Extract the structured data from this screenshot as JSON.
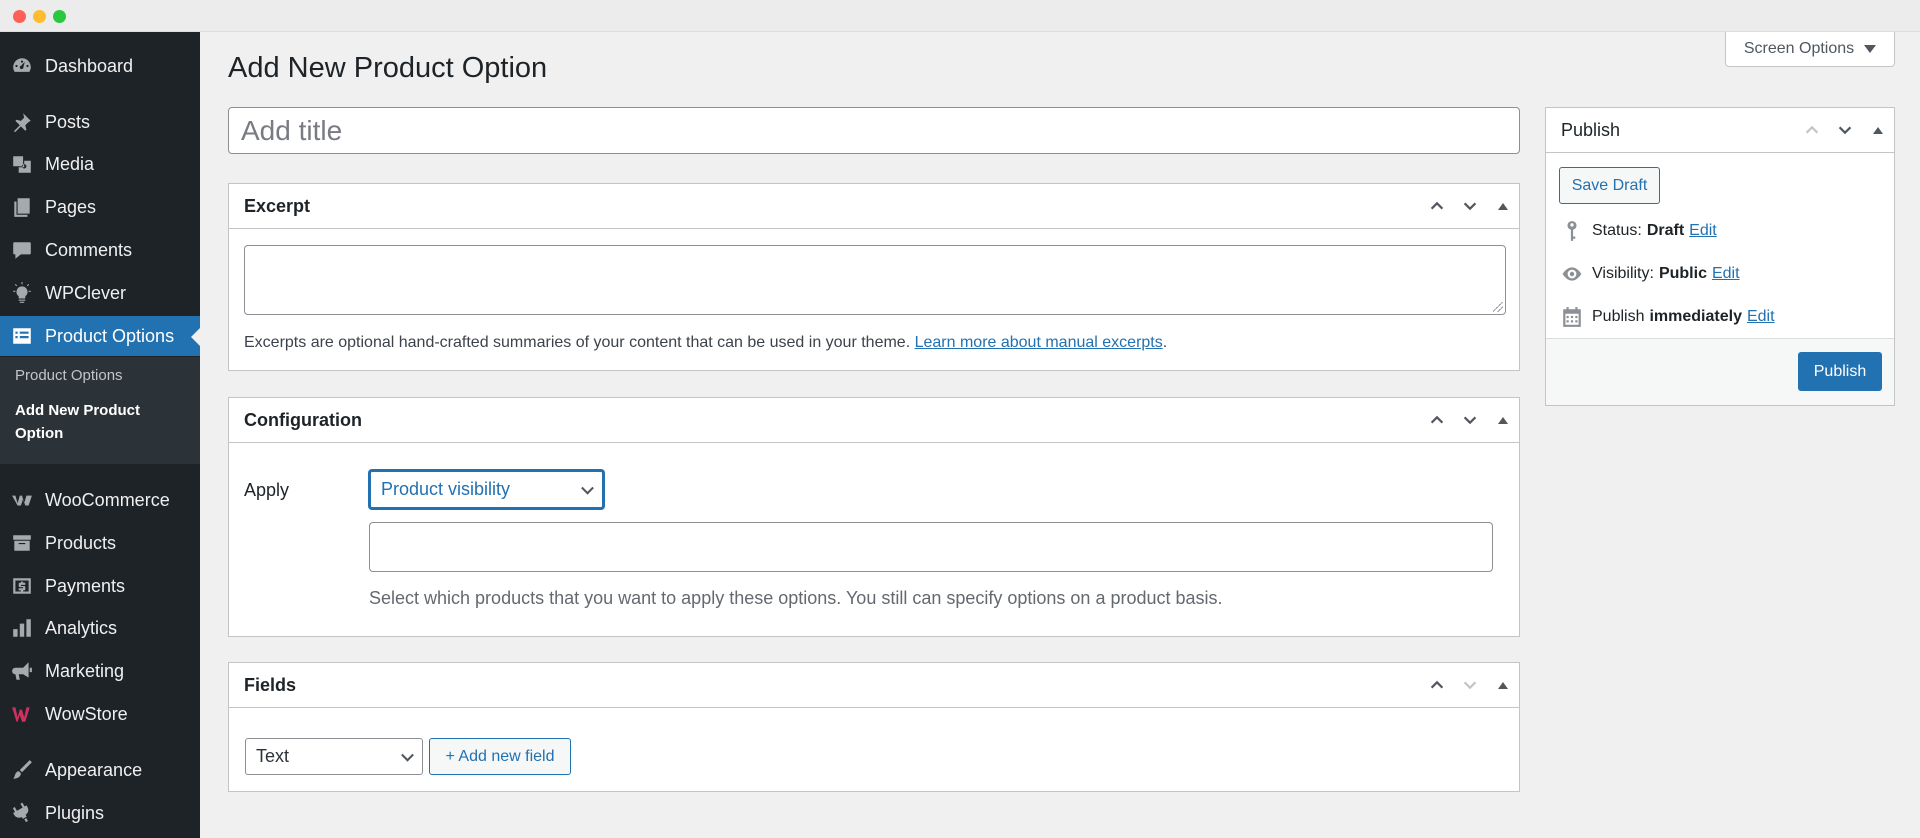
{
  "sidebar": {
    "items": [
      {
        "label": "Dashboard",
        "icon": "dashboard-icon"
      },
      {
        "label": "Posts",
        "icon": "pin-icon"
      },
      {
        "label": "Media",
        "icon": "media-icon"
      },
      {
        "label": "Pages",
        "icon": "pages-icon"
      },
      {
        "label": "Comments",
        "icon": "comment-icon"
      },
      {
        "label": "WPClever",
        "icon": "lightbulb-icon"
      },
      {
        "label": "Product Options",
        "icon": "list-icon"
      },
      {
        "label": "WooCommerce",
        "icon": "woocommerce-icon"
      },
      {
        "label": "Products",
        "icon": "archive-icon"
      },
      {
        "label": "Payments",
        "icon": "dollar-icon"
      },
      {
        "label": "Analytics",
        "icon": "bar-chart-icon"
      },
      {
        "label": "Marketing",
        "icon": "megaphone-icon"
      },
      {
        "label": "WowStore",
        "icon": "wowstore-icon"
      },
      {
        "label": "Appearance",
        "icon": "brush-icon"
      },
      {
        "label": "Plugins",
        "icon": "plugin-icon"
      }
    ],
    "submenu": {
      "items": [
        "Product Options",
        "Add New Product Option"
      ]
    }
  },
  "screen_options": {
    "label": "Screen Options"
  },
  "page": {
    "title": "Add New Product Option",
    "title_placeholder": "Add title"
  },
  "excerpt": {
    "heading": "Excerpt",
    "help_text": "Excerpts are optional hand-crafted summaries of your content that can be used in your theme.",
    "help_link": "Learn more about manual excerpts",
    "help_end": "."
  },
  "configuration": {
    "heading": "Configuration",
    "apply_label": "Apply",
    "apply_value": "Product visibility",
    "help_text": "Select which products that you want to apply these options. You still can specify options on a product basis."
  },
  "fields": {
    "heading": "Fields",
    "type_value": "Text",
    "add_button": "+ Add new field"
  },
  "publish": {
    "heading": "Publish",
    "save_draft": "Save Draft",
    "status_label": "Status:",
    "status_value": "Draft",
    "visibility_label": "Visibility:",
    "visibility_value": "Public",
    "publish_label": "Publish",
    "publish_value": "immediately",
    "edit_label": "Edit",
    "publish_button": "Publish"
  },
  "colors": {
    "sidebar_bg": "#1d2327",
    "accent": "#2271b1",
    "submenu_bg": "#2c3338"
  }
}
